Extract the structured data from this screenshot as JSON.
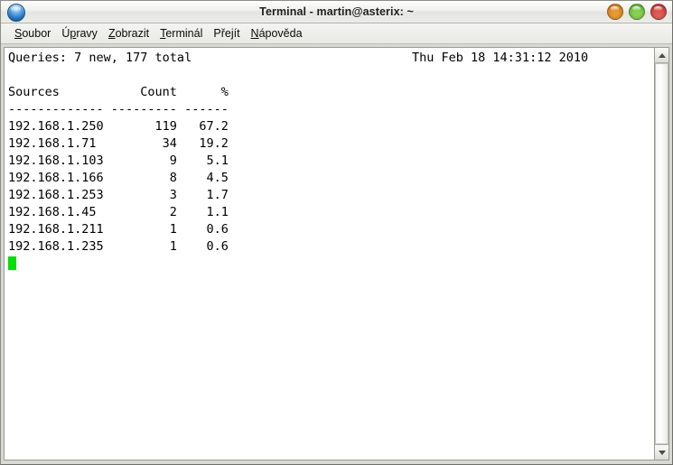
{
  "window": {
    "title": "Terminal - martin@asterix: ~",
    "app_icon": "blue-circle-icon",
    "buttons": {
      "minimize": "minimize-button",
      "maximize": "maximize-button",
      "close": "close-button"
    }
  },
  "menubar": {
    "items": [
      {
        "label": "Soubor",
        "pre": "",
        "mnemonic": "S",
        "post": "oubor"
      },
      {
        "label": "Úpravy",
        "pre": "Ú",
        "mnemonic": "p",
        "post": "ravy"
      },
      {
        "label": "Zobrazit",
        "pre": "",
        "mnemonic": "Z",
        "post": "obrazit"
      },
      {
        "label": "Terminál",
        "pre": "",
        "mnemonic": "T",
        "post": "erminál"
      },
      {
        "label": "Přejít",
        "pre": "Pře",
        "mnemonic": "j",
        "post": "ít"
      },
      {
        "label": "Nápověda",
        "pre": "",
        "mnemonic": "N",
        "post": "ápověda"
      }
    ]
  },
  "terminal": {
    "status_line": "Queries: 7 new, 177 total",
    "timestamp": "Thu Feb 18 14:31:12 2010",
    "queries_new": 7,
    "queries_total": 177,
    "columns": [
      "Sources",
      "Count",
      "%"
    ],
    "separator": "------------- --------- ------",
    "header_line": "Sources           Count       %",
    "rows": [
      {
        "source": "192.168.1.250",
        "count": "119",
        "percent": "67.2"
      },
      {
        "source": "192.168.1.71",
        "count": "34",
        "percent": "19.2"
      },
      {
        "source": "192.168.1.103",
        "count": "9",
        "percent": "5.1"
      },
      {
        "source": "192.168.1.166",
        "count": "8",
        "percent": "4.5"
      },
      {
        "source": "192.168.1.253",
        "count": "3",
        "percent": "1.7"
      },
      {
        "source": "192.168.1.45",
        "count": "2",
        "percent": "1.1"
      },
      {
        "source": "192.168.1.211",
        "count": "1",
        "percent": "0.6"
      },
      {
        "source": "192.168.1.235",
        "count": "1",
        "percent": "0.6"
      }
    ],
    "cursor": "block-cursor",
    "cursor_color": "#00e000",
    "background_color": "#ffffff",
    "foreground_color": "#000000"
  },
  "scrollbar": {
    "up_arrow": "scroll-up-arrow-icon",
    "down_arrow": "scroll-down-arrow-icon",
    "thumb": "scrollbar-thumb"
  }
}
